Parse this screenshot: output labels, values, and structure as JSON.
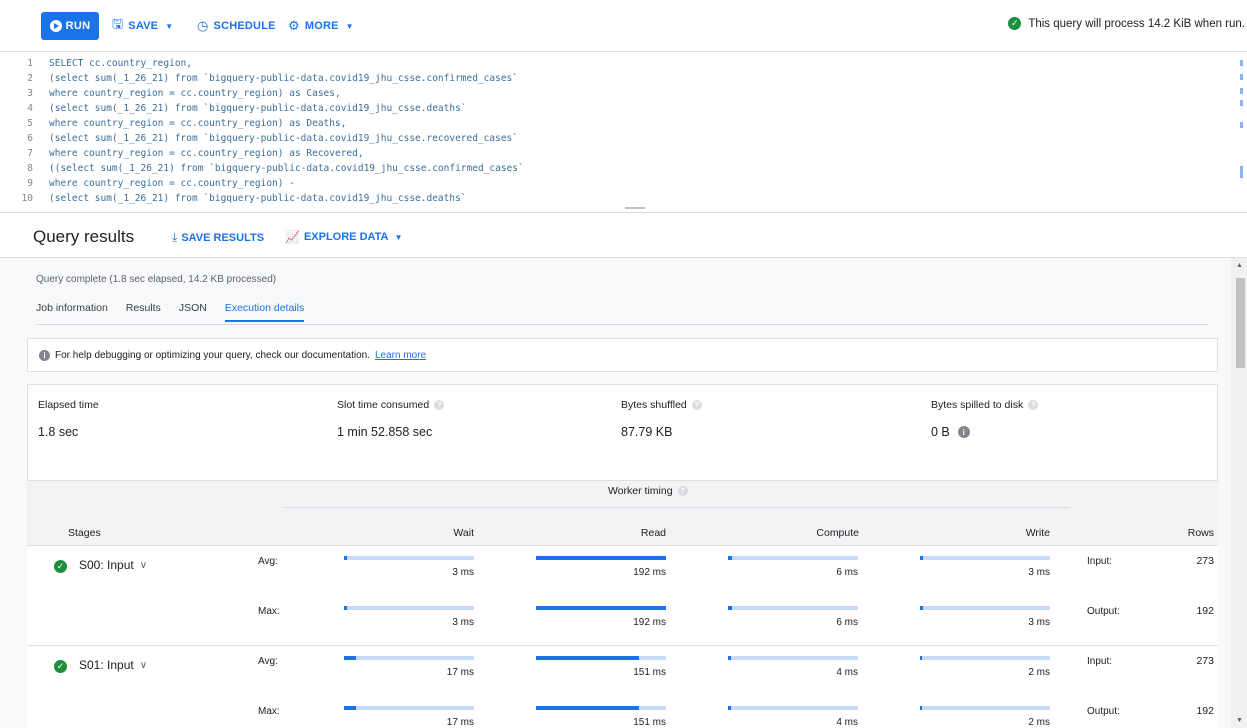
{
  "toolbar": {
    "run_label": "RUN",
    "save_label": "SAVE",
    "schedule_label": "SCHEDULE",
    "more_label": "MORE",
    "process_message": "This query will process 14.2 KiB when run."
  },
  "editor": {
    "lines": [
      {
        "n": "1",
        "text": "SELECT cc.country_region,"
      },
      {
        "n": "2",
        "text": "(select sum(_1_26_21) from `bigquery-public-data.covid19_jhu_csse.confirmed_cases`"
      },
      {
        "n": "3",
        "text": "where country_region = cc.country_region) as Cases,"
      },
      {
        "n": "4",
        "text": "(select sum(_1_26_21) from `bigquery-public-data.covid19_jhu_csse.deaths`"
      },
      {
        "n": "5",
        "text": "where country_region = cc.country_region) as Deaths,"
      },
      {
        "n": "6",
        "text": "(select sum(_1_26_21) from `bigquery-public-data.covid19_jhu_csse.recovered_cases`"
      },
      {
        "n": "7",
        "text": "where country_region = cc.country_region) as Recovered,"
      },
      {
        "n": "8",
        "text": "((select sum(_1_26_21) from `bigquery-public-data.covid19_jhu_csse.confirmed_cases`"
      },
      {
        "n": "9",
        "text": "where country_region = cc.country_region) -"
      },
      {
        "n": "10",
        "text": "(select sum(_1_26_21) from `bigquery-public-data.covid19_jhu_csse.deaths`"
      }
    ]
  },
  "results": {
    "title": "Query results",
    "save_results_label": "SAVE RESULTS",
    "explore_data_label": "EXPLORE DATA",
    "status": "Query complete (1.8 sec elapsed, 14.2 KB processed)",
    "tabs": [
      "Job information",
      "Results",
      "JSON",
      "Execution details"
    ],
    "active_tab": "Execution details",
    "info_text": "For help debugging or optimizing your query, check our documentation.",
    "learn_more": "Learn more"
  },
  "metrics": {
    "elapsed": {
      "label": "Elapsed time",
      "value": "1.8 sec"
    },
    "slot": {
      "label": "Slot time consumed",
      "value": "1 min 52.858 sec"
    },
    "shuffled": {
      "label": "Bytes shuffled",
      "value": "87.79 KB"
    },
    "spilled": {
      "label": "Bytes spilled to disk",
      "value": "0 B"
    }
  },
  "timing": {
    "worker_timing": "Worker timing",
    "stages_header": "Stages",
    "wait_header": "Wait",
    "read_header": "Read",
    "compute_header": "Compute",
    "write_header": "Write",
    "rows_header": "Rows",
    "avg_label": "Avg:",
    "max_label": "Max:",
    "input_label": "Input:",
    "output_label": "Output:",
    "stages": [
      {
        "name": "S00: Input",
        "avg": {
          "wait": "3 ms",
          "read": "192 ms",
          "compute": "6 ms",
          "write": "3 ms"
        },
        "max": {
          "wait": "3 ms",
          "read": "192 ms",
          "compute": "6 ms",
          "write": "3 ms"
        },
        "avg_fill": {
          "wait": 0.02,
          "read": 1.0,
          "compute": 0.03,
          "write": 0.02
        },
        "max_fill": {
          "wait": 0.02,
          "read": 1.0,
          "compute": 0.03,
          "write": 0.02
        },
        "input_rows": "273",
        "output_rows": "192"
      },
      {
        "name": "S01: Input",
        "avg": {
          "wait": "17 ms",
          "read": "151 ms",
          "compute": "4 ms",
          "write": "2 ms"
        },
        "max": {
          "wait": "17 ms",
          "read": "151 ms",
          "compute": "4 ms",
          "write": "2 ms"
        },
        "avg_fill": {
          "wait": 0.09,
          "read": 0.79,
          "compute": 0.02,
          "write": 0.01
        },
        "max_fill": {
          "wait": 0.09,
          "read": 0.79,
          "compute": 0.02,
          "write": 0.01
        },
        "input_rows": "273",
        "output_rows": "192"
      }
    ]
  },
  "colors": {
    "accent": "#1a73e8",
    "bar_track": "#c6dafc",
    "success": "#1e8e3e"
  }
}
